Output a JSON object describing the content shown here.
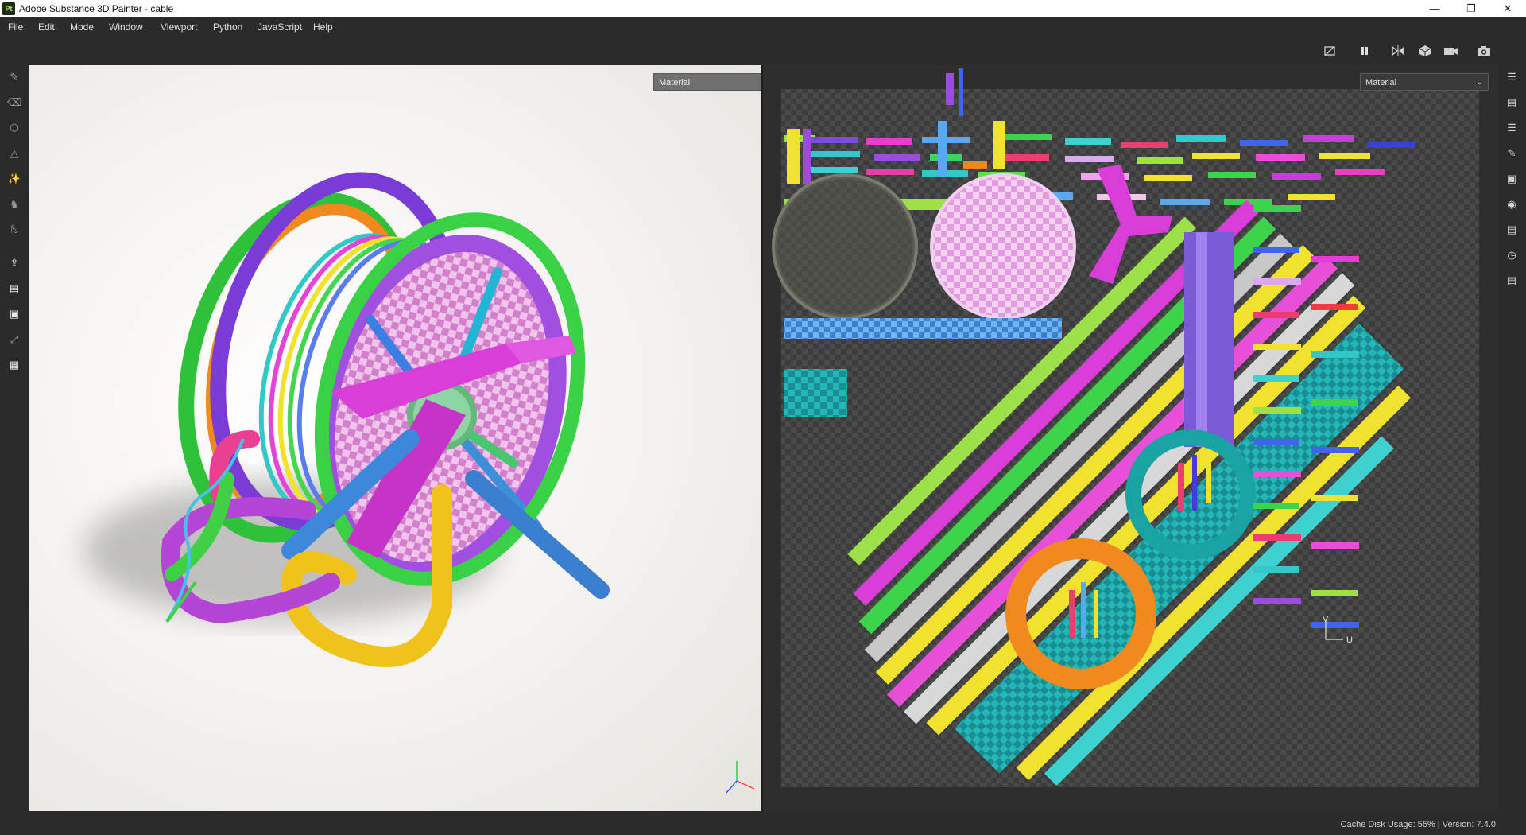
{
  "window": {
    "app_icon": "Pt",
    "title": "Adobe Substance 3D Painter - cable",
    "controls": [
      "minimize-icon",
      "restore-icon",
      "close-icon"
    ]
  },
  "menu": [
    "File",
    "Edit",
    "Mode",
    "Window",
    "Viewport",
    "Python",
    "JavaScript",
    "Help"
  ],
  "toolbar": {
    "icons": [
      "hide-uv-icon",
      "pause-icon",
      "split-view-icon",
      "cube-view-icon",
      "camera-icon",
      "screenshot-icon"
    ]
  },
  "left_tools": [
    "brush-icon",
    "eraser-icon",
    "projection-icon",
    "polygon-fill-icon",
    "smudge-icon",
    "clone-icon",
    "color-picker-icon",
    "export-icon",
    "bake-icon",
    "geometry-icon",
    "transform-icon",
    "texture-set-icon"
  ],
  "right_panels": [
    "texture-set-list-icon",
    "texture-set-settings-icon",
    "layers-icon",
    "properties-icon",
    "display-settings-icon",
    "shader-settings-icon",
    "assets-icon",
    "history-icon",
    "log-icon"
  ],
  "viewport_3d": {
    "channel_dropdown": "Material"
  },
  "viewport_2d": {
    "channel_dropdown": "Material",
    "axis_v": "V",
    "axis_u": "U"
  },
  "status": {
    "text": "Cache Disk Usage:    55% | Version: 7.4.0"
  }
}
